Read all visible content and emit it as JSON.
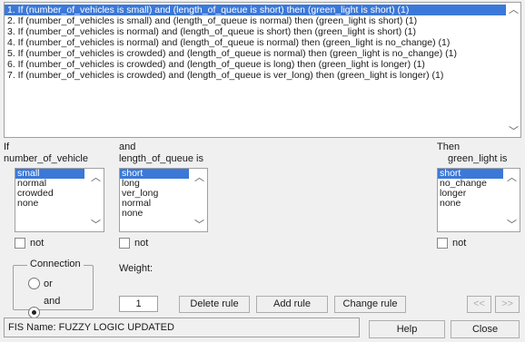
{
  "rules": [
    "1. If (number_of_vehicles is small) and (length_of_queue is short) then (green_light is short) (1)",
    "2. If (number_of_vehicles is small) and (length_of_queue is normal) then (green_light is short) (1)",
    "3. If (number_of_vehicles is normal) and (length_of_queue is short) then (green_light is short) (1)",
    "4. If (number_of_vehicles is normal) and (length_of_queue is normal) then (green_light is no_change) (1)",
    "5. If (number_of_vehicles is crowded) and (length_of_queue is normal) then (green_light is no_change) (1)",
    "6. If (number_of_vehicles is crowded) and (length_of_queue is long) then (green_light is longer) (1)",
    "7. If (number_of_vehicles is crowded) and (length_of_queue is ver_long) then (green_light is longer) (1)"
  ],
  "selected_rule_index": 0,
  "antecedent1": {
    "prefix": "If",
    "label": "number_of_vehicle",
    "options": [
      "small",
      "normal",
      "crowded",
      "none"
    ],
    "not_label": "not"
  },
  "antecedent2": {
    "prefix": "and",
    "label": "length_of_queue is",
    "options": [
      "short",
      "long",
      "ver_long",
      "normal",
      "none"
    ],
    "not_label": "not"
  },
  "consequent": {
    "prefix": "Then",
    "label": "green_light is",
    "options": [
      "short",
      "no_change",
      "longer",
      "none"
    ],
    "not_label": "not"
  },
  "connection": {
    "title": "Connection",
    "or_label": "or",
    "and_label": "and",
    "selected": "and"
  },
  "weight": {
    "label": "Weight:",
    "value": "1"
  },
  "buttons": {
    "delete": "Delete rule",
    "add": "Add rule",
    "change": "Change rule",
    "prev": "<<",
    "next": ">>",
    "help": "Help",
    "close": "Close"
  },
  "status": "FIS Name: FUZZY LOGIC UPDATED",
  "colors": {
    "selection": "#3b78d8",
    "background": "#f0f0f0"
  }
}
